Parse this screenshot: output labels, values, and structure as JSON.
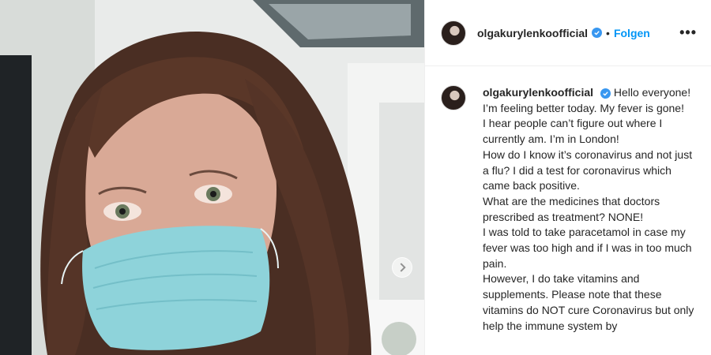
{
  "post": {
    "username": "olgakurylenkoofficial",
    "separator": "•",
    "follow_label": "Folgen",
    "more_label": "•••",
    "caption_first": "Hello everyone! I’m feeling better today. My fever is gone!",
    "caption_lines": [
      "I hear people can’t figure out where I currently am. I’m in London!",
      "How do I know it’s coronavirus and not just a flu? I did a test for coronavirus which came back positive.",
      "What are the medicines that doctors prescribed as treatment? NONE!",
      "I was told to take paracetamol in case my fever was too high and if I was in too much pain.",
      "However, I do take vitamins and supplements. Please note that these vitamins do NOT cure Coronavirus but only help the immune system by"
    ]
  },
  "icons": {
    "verified": "verified-badge-icon",
    "more": "more-options-icon",
    "carousel": "chevron-right-icon"
  },
  "colors": {
    "link": "#0095f6",
    "verified": "#3897f0",
    "text": "#262626",
    "mask": "#8ed3da"
  }
}
